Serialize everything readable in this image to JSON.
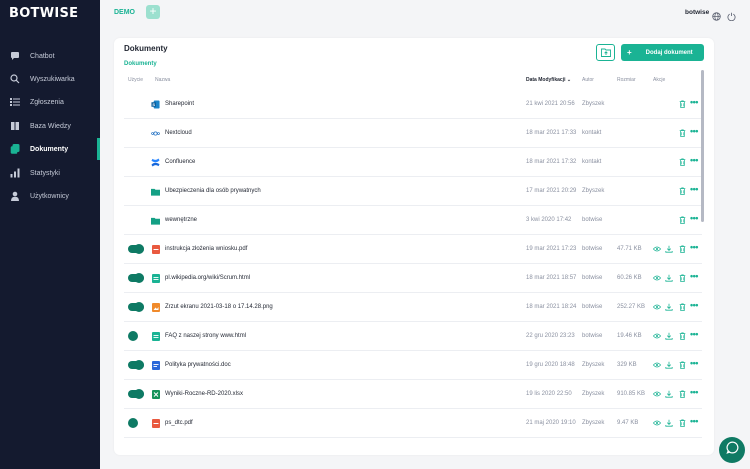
{
  "app": {
    "logo": "BOTWISE",
    "workspace": "DEMO",
    "username": "botwise"
  },
  "sidebar": {
    "items": [
      {
        "label": "Chatbot",
        "icon": "chat-icon"
      },
      {
        "label": "Wyszukiwarka",
        "icon": "search-icon"
      },
      {
        "label": "Zgłoszenia",
        "icon": "list-icon"
      },
      {
        "label": "Baza Wiedzy",
        "icon": "book-icon"
      },
      {
        "label": "Dokumenty",
        "icon": "documents-icon"
      },
      {
        "label": "Statystyki",
        "icon": "stats-icon"
      },
      {
        "label": "Użytkownicy",
        "icon": "user-icon"
      }
    ],
    "active_index": 4
  },
  "main": {
    "title": "Dokumenty",
    "breadcrumb": "Dokumenty",
    "add_button_label": "Dodaj dokument",
    "columns": {
      "usage": "Użycie",
      "name": "Nazwa",
      "modified": "Data Modyfikacji",
      "author": "Autor",
      "size": "Rozmiar",
      "actions": "Akcje"
    },
    "rows": [
      {
        "name": "Sharepoint",
        "date": "21 kwi 2021 20:56",
        "author": "Zbyszek",
        "size": "",
        "type": "sharepoint",
        "toggle": "none"
      },
      {
        "name": "Nextcloud",
        "date": "18 mar 2021 17:33",
        "author": "kontakt",
        "size": "",
        "type": "nextcloud",
        "toggle": "none"
      },
      {
        "name": "Confluence",
        "date": "18 mar 2021 17:32",
        "author": "kontakt",
        "size": "",
        "type": "confluence",
        "toggle": "none"
      },
      {
        "name": "Ubezpieczenia dla osób prywatnych",
        "date": "17 mar 2021 20:29",
        "author": "Zbyszek",
        "size": "",
        "type": "folder",
        "toggle": "none"
      },
      {
        "name": "wewnętrzne",
        "date": "3 kwi 2020 17:42",
        "author": "botwise",
        "size": "",
        "type": "folder",
        "toggle": "none"
      },
      {
        "name": "instrukcja złożenia wniosku.pdf",
        "date": "19 mar 2021 17:23",
        "author": "botwise",
        "size": "47.71 KB",
        "type": "pdf",
        "toggle": "on"
      },
      {
        "name": "pl.wikipedia.org/wiki/Scrum.html",
        "date": "18 mar 2021 18:57",
        "author": "botwise",
        "size": "60.26 KB",
        "type": "html",
        "toggle": "on"
      },
      {
        "name": "Zrzut ekranu 2021-03-18 o 17.14.28.png",
        "date": "18 mar 2021 18:24",
        "author": "botwise",
        "size": "252.27 KB",
        "type": "png",
        "toggle": "on"
      },
      {
        "name": "FAQ z naszej strony www.html",
        "date": "22 gru 2020 23:23",
        "author": "botwise",
        "size": "19.46 KB",
        "type": "html",
        "toggle": "off"
      },
      {
        "name": "Polityka prywatności.doc",
        "date": "19 gru 2020 18:48",
        "author": "Zbyszek",
        "size": "329 KB",
        "type": "doc",
        "toggle": "on"
      },
      {
        "name": "Wyniki-Roczne-RD-2020.xlsx",
        "date": "19 lis 2020 22:50",
        "author": "Zbyszek",
        "size": "910.85 KB",
        "type": "xlsx",
        "toggle": "on"
      },
      {
        "name": "ps_dtc.pdf",
        "date": "21 maj 2020 19:10",
        "author": "Zbyszek",
        "size": "9.47 KB",
        "type": "pdf",
        "toggle": "off"
      }
    ]
  },
  "colors": {
    "accent": "#1ab394",
    "sidebar_bg": "#141a2f",
    "toggle": "#0e7a64"
  }
}
